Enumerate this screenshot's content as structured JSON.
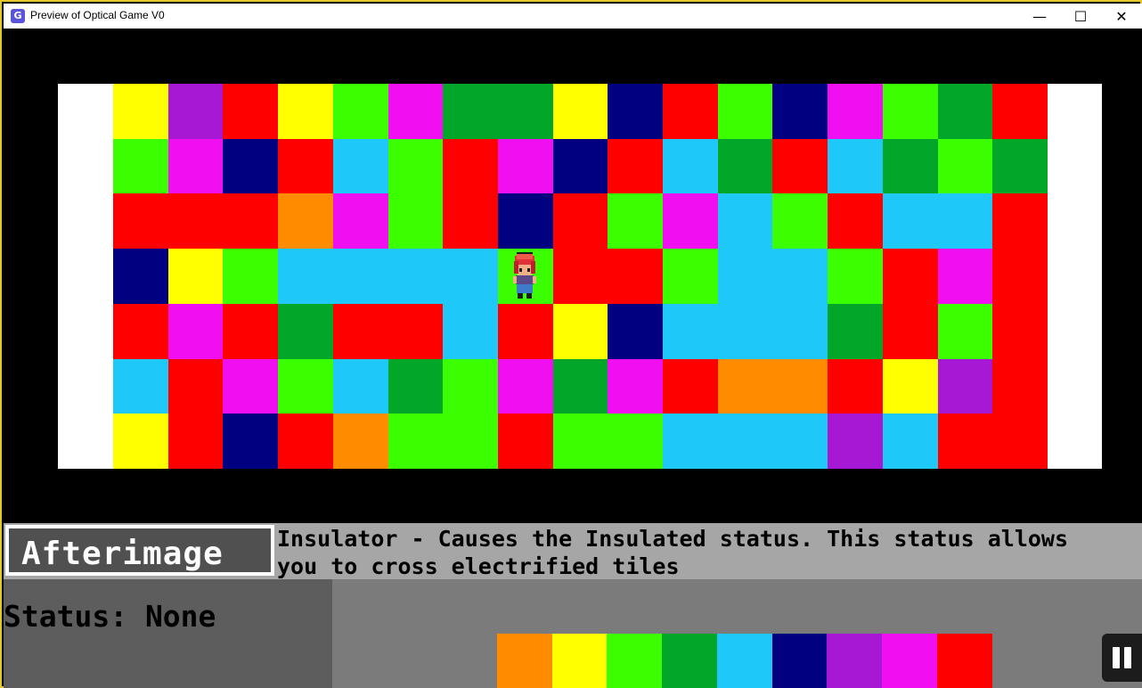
{
  "window": {
    "title": "Preview of Optical Game V0",
    "app_icon": "gamemaker-icon",
    "min_glyph": "—",
    "max_glyph": "☐",
    "close_glyph": "✕"
  },
  "colors": {
    "Y": "#ffff00",
    "P": "#a718d5",
    "R": "#ff0000",
    "L": "#3bff00",
    "M": "#f00ff0",
    "G": "#02a628",
    "N": "#000080",
    "C": "#1ec8f8",
    "O": "#ff8c00",
    "W": "#ffffff"
  },
  "board": {
    "rows": [
      "YPRYLMGGYNRLNMLGR",
      "LMNRCLRMNRCGRCGLG",
      "RRROMLRNRLMCLRCCR",
      "NYLCCCCLRRLCCLRMR",
      "RMRGRRCRYNCCCGRLR",
      "CRMLCGLMGMROORYPR",
      "YRNROLLRLLCCCPCRR"
    ],
    "player": {
      "row": 3,
      "col": 7,
      "name": "player-sprite"
    }
  },
  "ability": {
    "name": "Afterimage",
    "description_line1": "Insulator - Causes the Insulated status. This status allows",
    "description_line2": "you to cross electrified tiles"
  },
  "status": {
    "text": "Status: None"
  },
  "palette": [
    "O",
    "Y",
    "L",
    "G",
    "C",
    "N",
    "P",
    "M",
    "R"
  ],
  "pause": {
    "icon": "pause-icon"
  }
}
